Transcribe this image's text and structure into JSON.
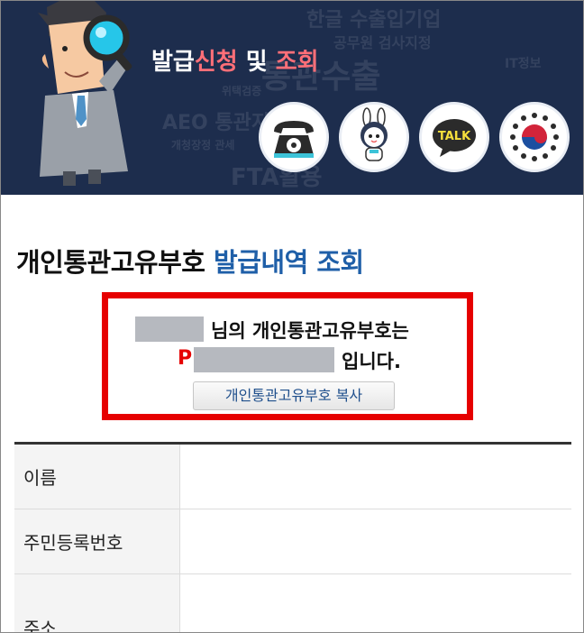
{
  "banner": {
    "title_part1": "발급",
    "title_part2": "신청",
    "title_part3": " 및 ",
    "title_part4": "조회",
    "background_words": [
      "한글 수출입기업",
      "공무원 검사지정",
      "통관수출",
      "위택검증",
      "AEO 통관지원",
      "개청장정 관세",
      "FTA활용",
      "IT정보"
    ],
    "icons": [
      {
        "name": "phone-icon"
      },
      {
        "name": "mascot-character-icon"
      },
      {
        "name": "kakaotalk-icon",
        "label": "TALK"
      },
      {
        "name": "government-emblem-icon"
      }
    ],
    "colors": {
      "background": "#1d2d4d",
      "accent": "#ff6f78"
    }
  },
  "heading": {
    "part1": "개인통관고유부호 ",
    "part2": "발급내역 조회",
    "accent_color": "#1f5fa8"
  },
  "result": {
    "line1_suffix": "님의 개인통관고유부호는",
    "code_prefix": "P",
    "line2_suffix": "입니다.",
    "copy_button": "개인통관고유부호 복사",
    "highlight_color": "#e60000"
  },
  "table": {
    "rows": [
      {
        "label": "이름",
        "value": ""
      },
      {
        "label": "주민등록번호",
        "value": ""
      },
      {
        "label": "주소",
        "value": ""
      }
    ]
  }
}
